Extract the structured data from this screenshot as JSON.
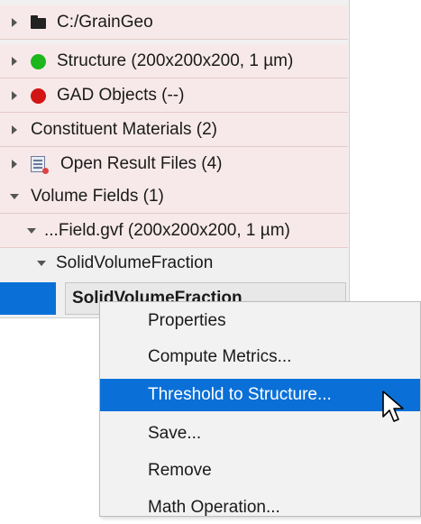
{
  "tree": {
    "items": [
      {
        "label": "C:/GrainGeo",
        "icon": "folder-icon",
        "expanded": false
      },
      {
        "label": "Structure (200x200x200, 1 µm)",
        "icon": "status-dot-icon",
        "icon_color": "#1db61d",
        "expanded": false
      },
      {
        "label": "GAD Objects (--)",
        "icon": "status-dot-icon",
        "icon_color": "#d21414",
        "expanded": false
      },
      {
        "label": "Constituent Materials (2)",
        "icon": "",
        "expanded": false
      },
      {
        "label": "Open Result Files (4)",
        "icon": "result-files-icon",
        "expanded": false
      },
      {
        "label": "Volume Fields (1)",
        "icon": "",
        "expanded": true
      },
      {
        "label": "...Field.gvf (200x200x200, 1 µm)",
        "icon": "",
        "expanded": true
      },
      {
        "label": "SolidVolumeFraction",
        "icon": "",
        "expanded": true
      }
    ],
    "selected": {
      "label": "SolidVolumeFraction"
    }
  },
  "context_menu": {
    "items": [
      {
        "label": "Properties"
      },
      {
        "label": "Compute Metrics..."
      },
      {
        "label": "Threshold to Structure...",
        "active": true
      },
      {
        "label": "Save..."
      },
      {
        "label": "Remove"
      },
      {
        "label": "Math Operation..."
      }
    ]
  },
  "colors": {
    "selection": "#0a70d8",
    "row_highlight": "#f7e9e9",
    "status_green": "#1db61d",
    "status_red": "#d21414"
  }
}
